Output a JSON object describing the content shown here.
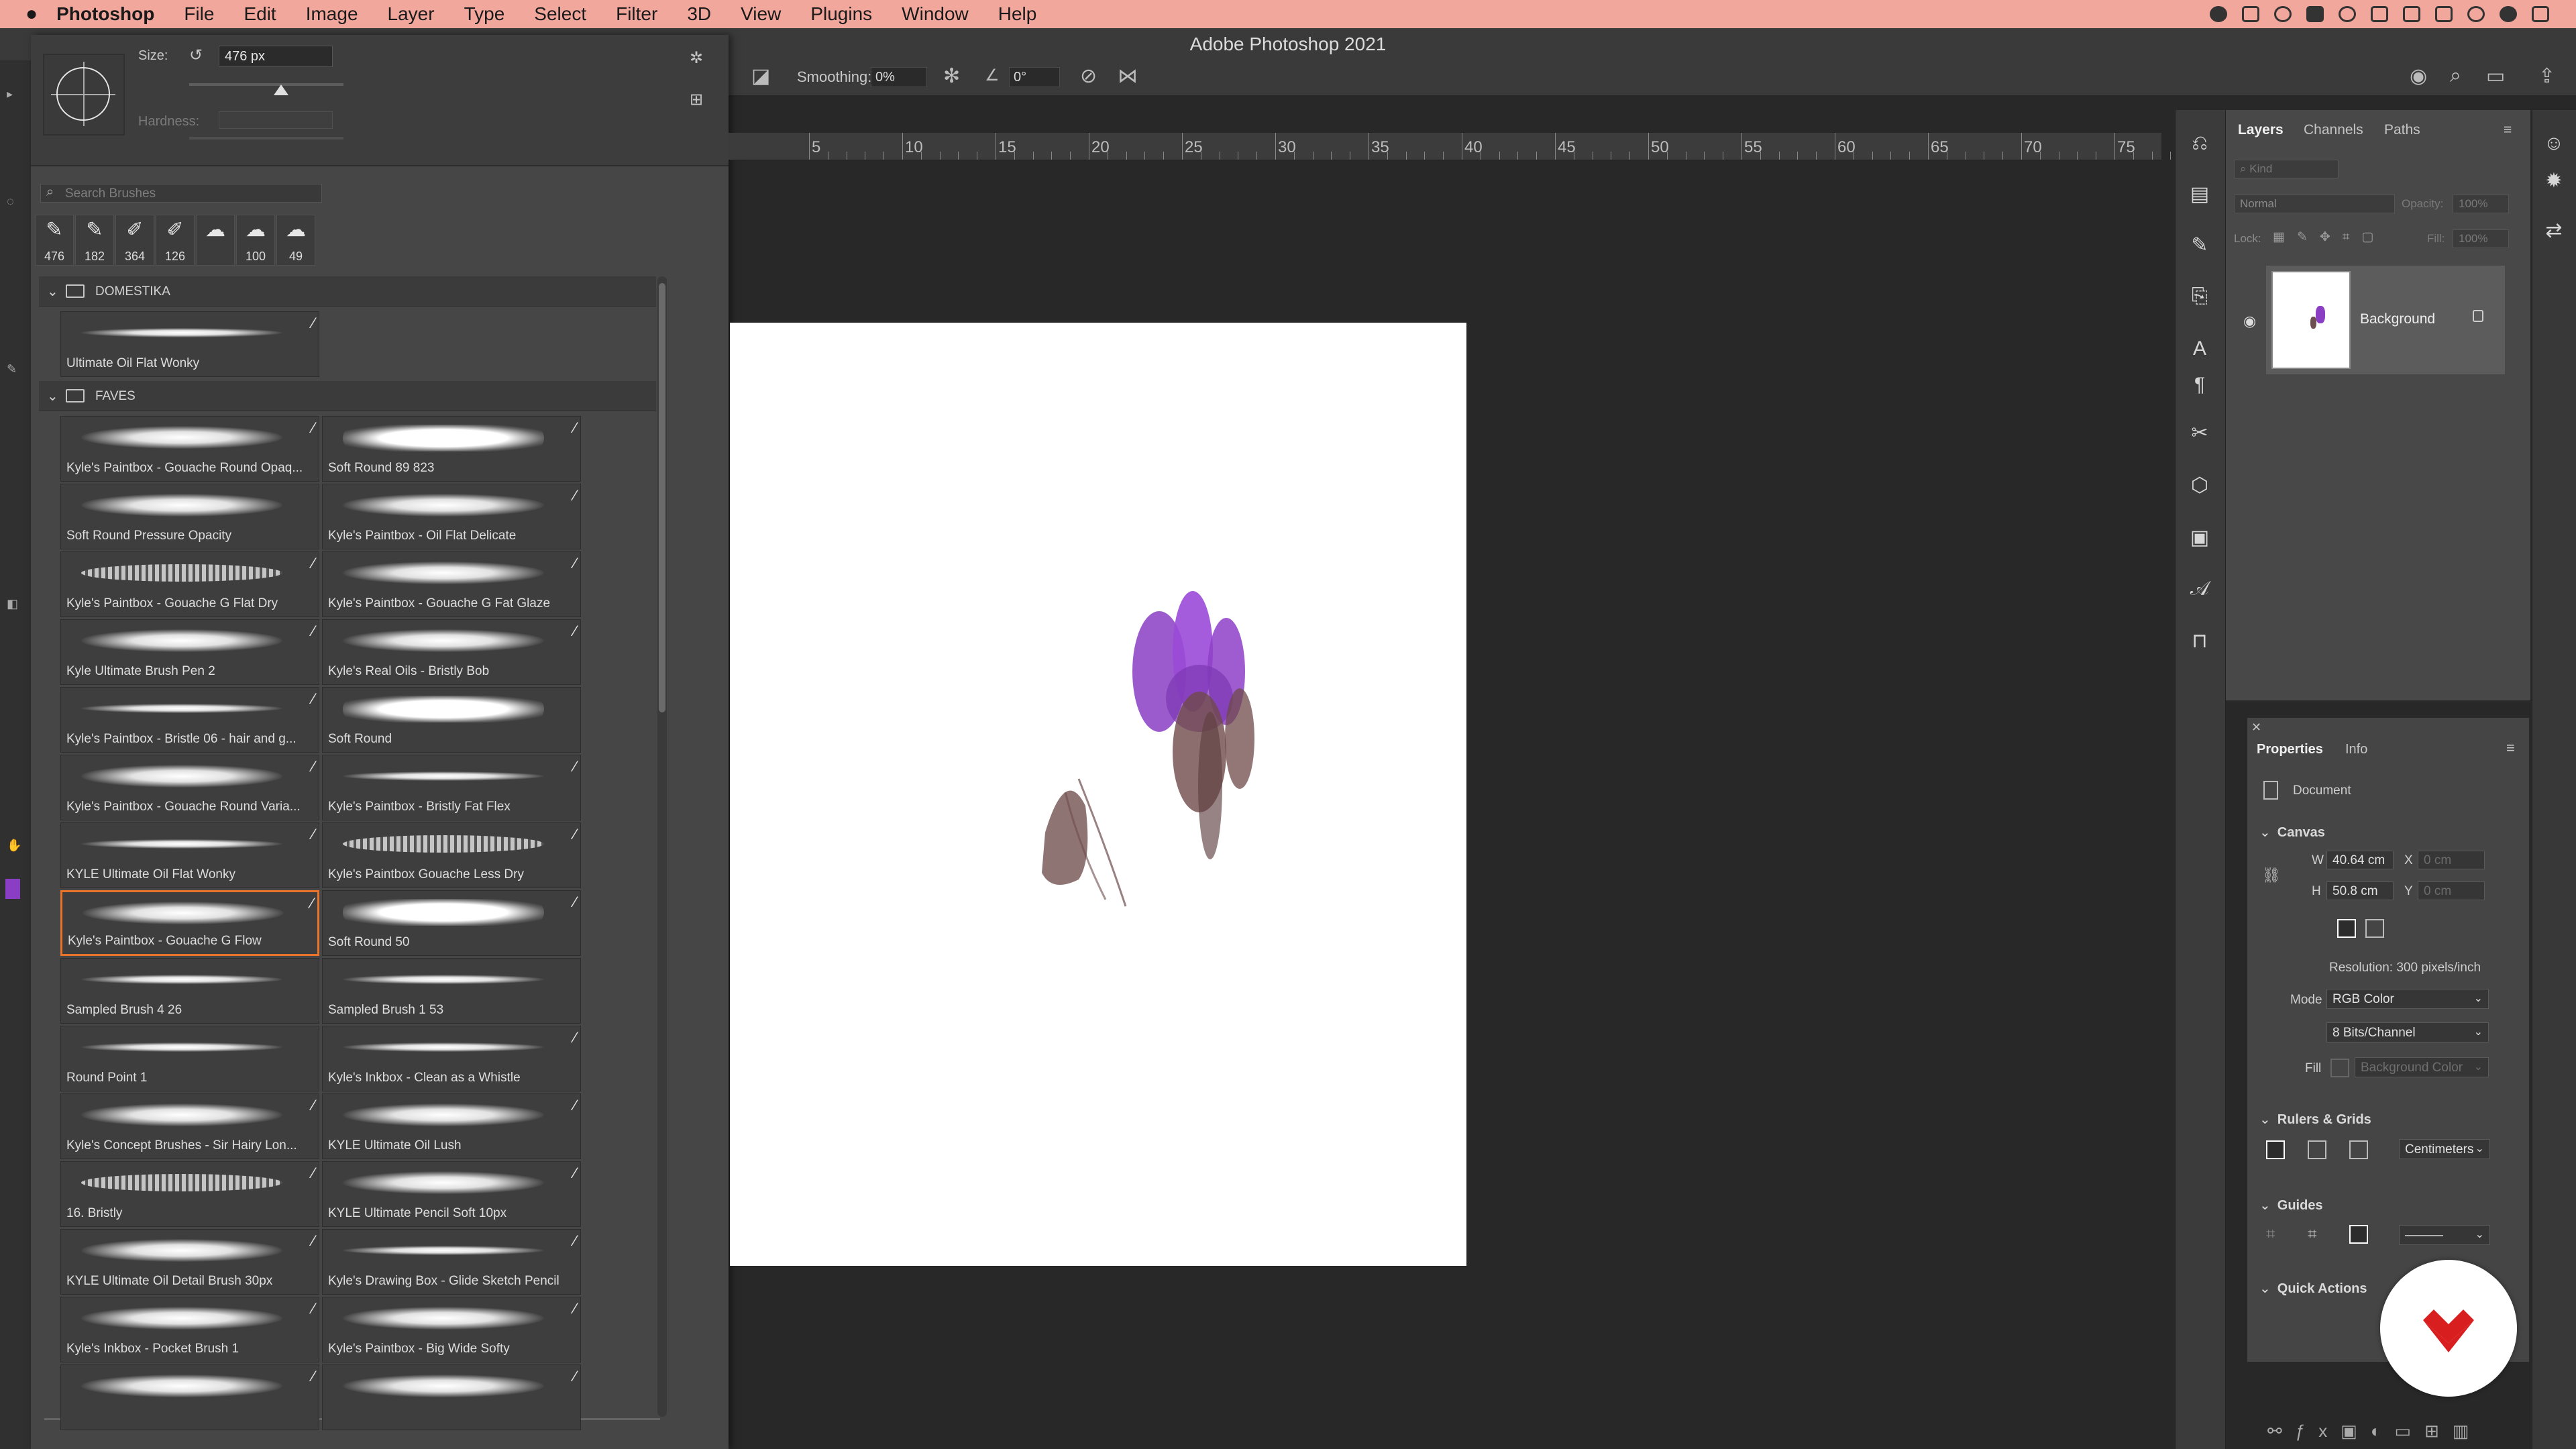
{
  "menubar": {
    "app_name": "Photoshop",
    "items": [
      "File",
      "Edit",
      "Image",
      "Layer",
      "Type",
      "Select",
      "Filter",
      "3D",
      "View",
      "Plugins",
      "Window",
      "Help"
    ]
  },
  "window": {
    "title": "Adobe Photoshop 2021"
  },
  "options_bar": {
    "smoothing_label": "Smoothing:",
    "smoothing_value": "0%",
    "angle_value": "0°"
  },
  "brush_panel": {
    "size_label": "Size:",
    "size_value": "476 px",
    "hardness_label": "Hardness:",
    "search_placeholder": "Search Brushes",
    "recent_sizes": [
      "476",
      "182",
      "364",
      "126",
      "",
      "100",
      "49"
    ],
    "groups": [
      {
        "name": "DOMESTIKA",
        "brushes": [
          "Ultimate Oil Flat Wonky"
        ]
      },
      {
        "name": "FAVES",
        "brushes": [
          "Kyle's Paintbox - Gouache Round Opaq...",
          "Soft Round 89 823",
          "Soft Round Pressure Opacity",
          "Kyle's Paintbox - Oil Flat Delicate",
          "Kyle's Paintbox - Gouache G Flat Dry",
          "Kyle's Paintbox - Gouache G Fat Glaze",
          "Kyle Ultimate Brush Pen 2",
          "Kyle's Real Oils - Bristly Bob",
          "Kyle's Paintbox - Bristle 06 - hair and g...",
          "Soft Round",
          "Kyle's Paintbox - Gouache Round Varia...",
          "Kyle's Paintbox - Bristly Fat Flex",
          "KYLE Ultimate Oil Flat Wonky",
          "Kyle's Paintbox Gouache Less Dry",
          "Kyle's Paintbox - Gouache G Flow",
          "Soft Round 50",
          "Sampled Brush 4 26",
          "Sampled Brush 1 53",
          "Round Point 1",
          "Kyle's Inkbox - Clean as a Whistle",
          "Kyle's Concept Brushes - Sir Hairy Lon...",
          "KYLE Ultimate Oil Lush",
          "16. Bristly",
          "KYLE Ultimate Pencil Soft 10px",
          "KYLE Ultimate Oil Detail Brush 30px",
          "Kyle's Drawing Box - Glide Sketch Pencil",
          "Kyle's Inkbox -  Pocket Brush 1",
          "Kyle's Paintbox - Big Wide Softy",
          "",
          ""
        ],
        "selected_brush": "Kyle's Paintbox - Gouache G Flow"
      }
    ]
  },
  "ruler": {
    "ticks": [
      "5",
      "10",
      "15",
      "20",
      "25",
      "30",
      "35",
      "40",
      "45",
      "50",
      "55",
      "60",
      "65",
      "70",
      "75"
    ]
  },
  "layers_panel": {
    "tabs": [
      "Layers",
      "Channels",
      "Paths"
    ],
    "active_tab": "Layers",
    "kind_placeholder": "Kind",
    "blend_mode": "Normal",
    "opacity_label": "Opacity:",
    "opacity_value": "100%",
    "lock_label": "Lock:",
    "fill_label": "Fill:",
    "fill_value": "100%",
    "layers": [
      {
        "name": "Background",
        "visible": true,
        "locked": true
      }
    ]
  },
  "properties_panel": {
    "tabs": [
      "Properties",
      "Info"
    ],
    "active_tab": "Properties",
    "document_label": "Document",
    "canvas_section": "Canvas",
    "w_label": "W",
    "w_value": "40.64 cm",
    "h_label": "H",
    "h_value": "50.8 cm",
    "x_label": "X",
    "x_placeholder": "0 cm",
    "y_label": "Y",
    "y_placeholder": "0 cm",
    "resolution": "Resolution: 300 pixels/inch",
    "mode_label": "Mode",
    "mode_value": "RGB Color",
    "bits_value": "8 Bits/Channel",
    "fill_label": "Fill",
    "fill_value": "Background Color",
    "rulers_section": "Rulers & Grids",
    "units_value": "Centimeters",
    "guides_section": "Guides",
    "quick_actions_section": "Quick Actions"
  },
  "colors": {
    "menubar": "#f2a79c",
    "selection_accent": "#e8742b",
    "paint_purple": "#8a3ec4",
    "paint_brown": "#6f5050",
    "badge_red": "#d81e1e"
  }
}
